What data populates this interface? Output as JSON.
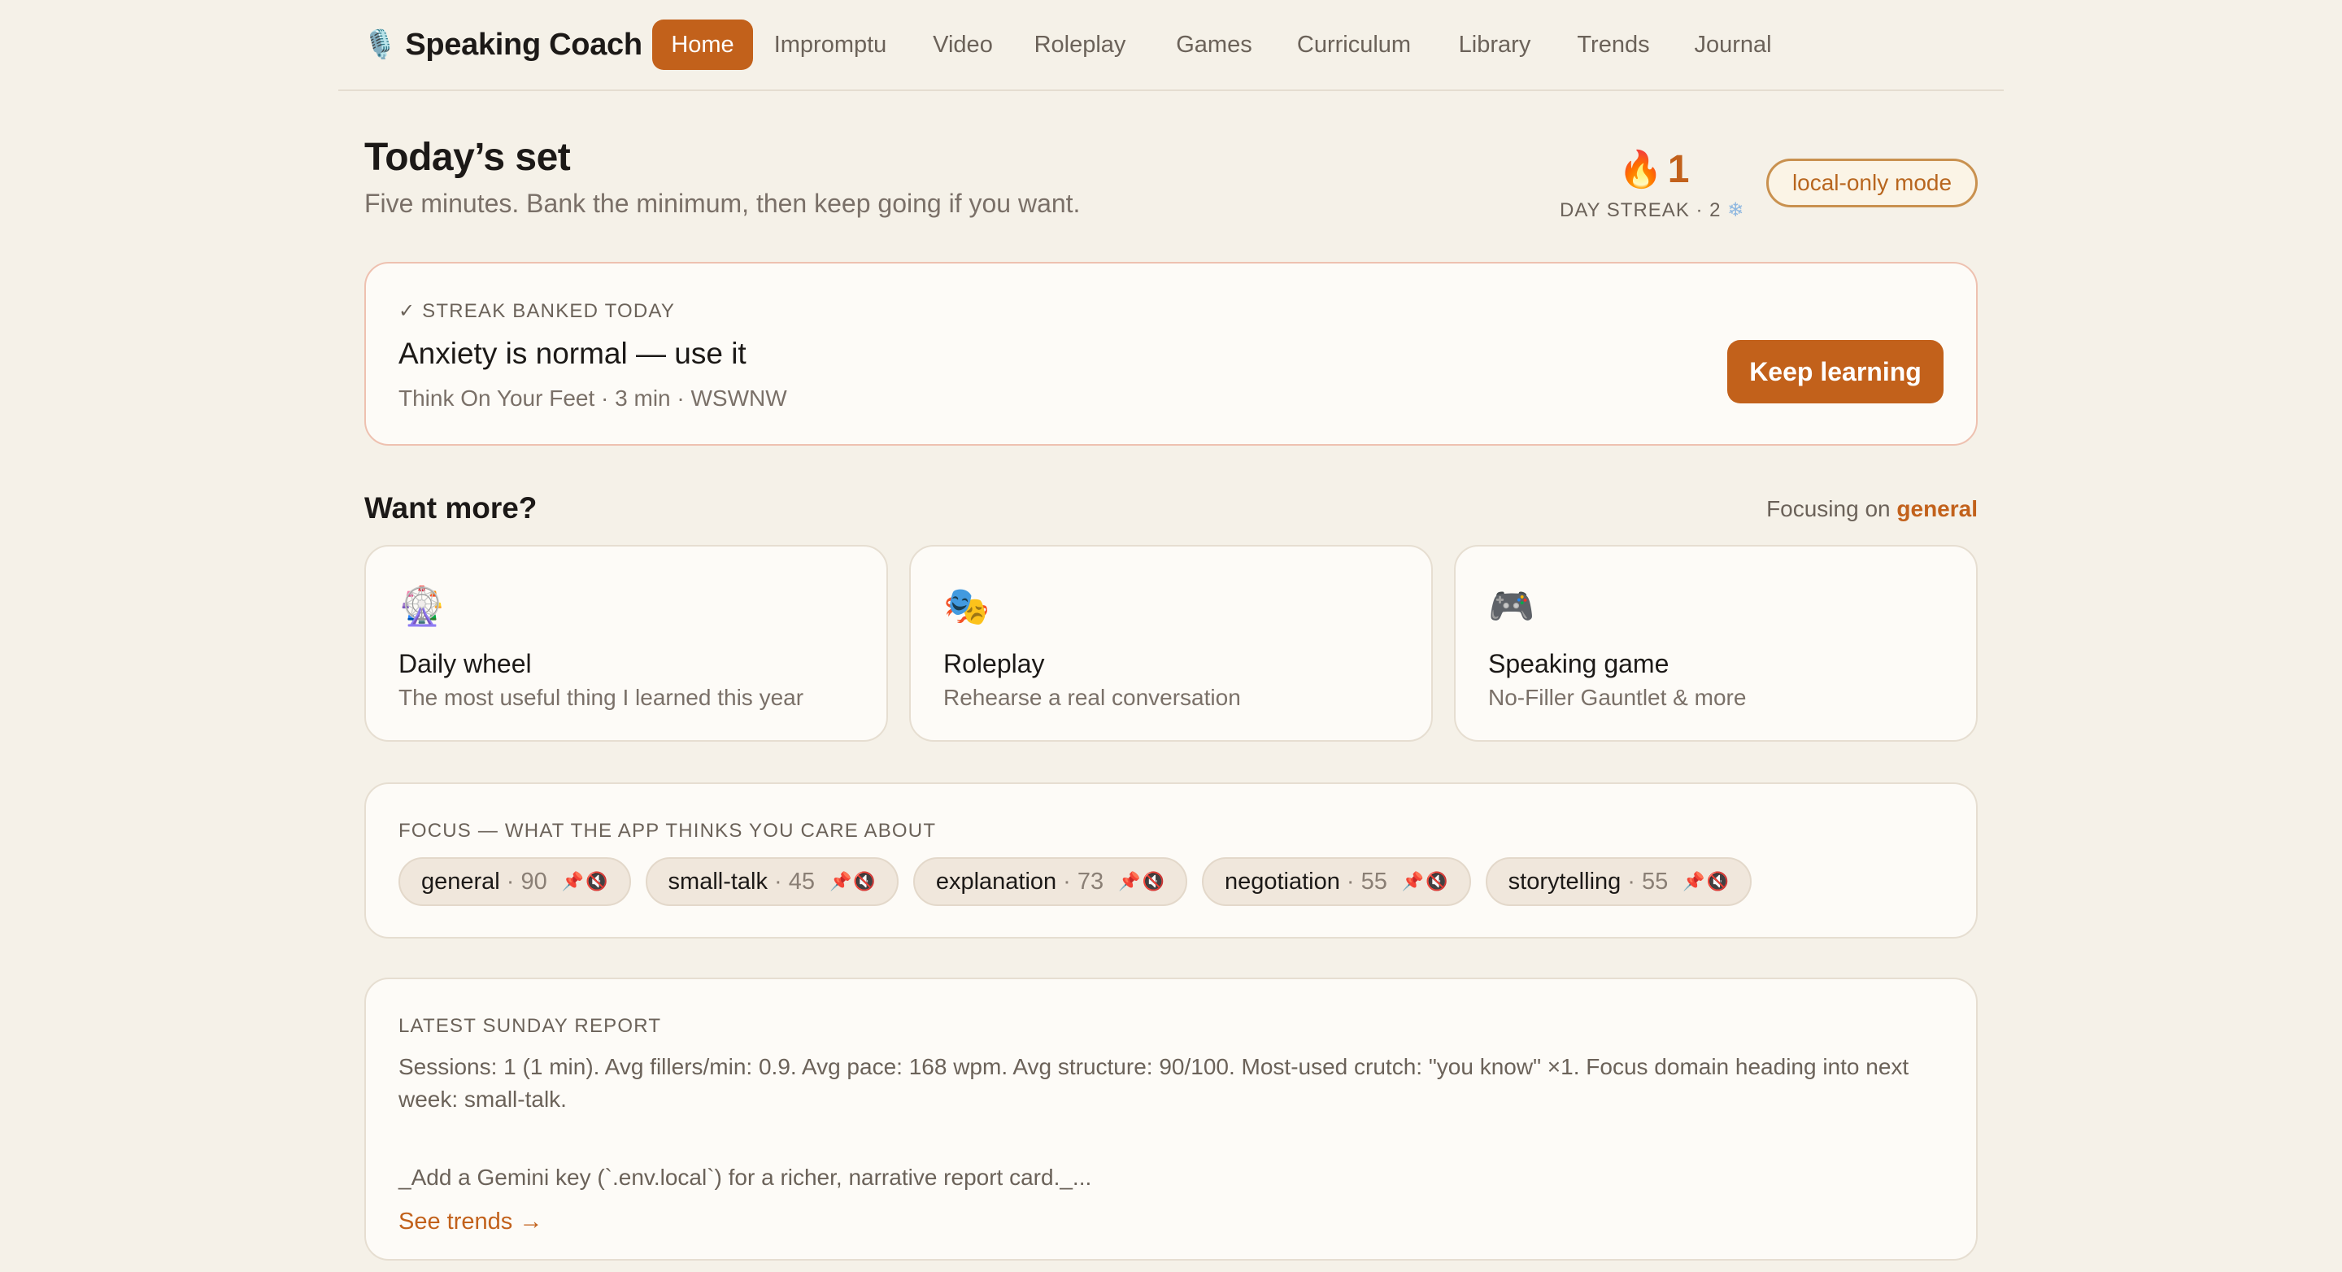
{
  "app": {
    "brand_icon": "microphone-icon",
    "brand_glyph": "🎙️",
    "name": "Speaking Coach"
  },
  "nav": {
    "items": [
      {
        "label": "Home",
        "active": true
      },
      {
        "label": "Impromptu"
      },
      {
        "label": "Video"
      },
      {
        "label": "Roleplay"
      },
      {
        "label": "Games"
      },
      {
        "label": "Curriculum"
      },
      {
        "label": "Library"
      },
      {
        "label": "Trends"
      },
      {
        "label": "Journal"
      }
    ]
  },
  "header": {
    "title": "Today’s set",
    "subtitle": "Five minutes. Bank the minimum, then keep going if you want.",
    "streak": {
      "icon": "flame-icon",
      "glyph": "🔥",
      "count": "1",
      "label": "DAY STREAK · 2",
      "freeze_icon": "snowflake-icon",
      "freeze_glyph": "❄"
    },
    "mode": "local-only mode"
  },
  "banked": {
    "eyebrow": "✓ STREAK BANKED TODAY",
    "title": "Anxiety is normal — use it",
    "meta": "Think On Your Feet · 3 min · WSWNW",
    "cta": "Keep learning"
  },
  "more": {
    "title": "Want more?",
    "focusing_prefix": "Focusing on",
    "focusing_value": "general",
    "tiles": [
      {
        "icon": "ferris-wheel-icon",
        "glyph": "🎡",
        "title": "Daily wheel",
        "desc": "The most useful thing I learned this year"
      },
      {
        "icon": "theater-masks-icon",
        "glyph": "🎭",
        "title": "Roleplay",
        "desc": "Rehearse a real conversation"
      },
      {
        "icon": "game-controller-icon",
        "glyph": "🎮",
        "title": "Speaking game",
        "desc": "No-Filler Gauntlet & more"
      }
    ]
  },
  "focus": {
    "eyebrow": "FOCUS — WHAT THE APP THINKS YOU CARE ABOUT",
    "chips": [
      {
        "label": "general",
        "score": "· 90"
      },
      {
        "label": "small-talk",
        "score": "· 45"
      },
      {
        "label": "explanation",
        "score": "· 73"
      },
      {
        "label": "negotiation",
        "score": "· 55"
      },
      {
        "label": "storytelling",
        "score": "· 55"
      }
    ],
    "pin_glyph": "📌",
    "mute_glyph": "🔇"
  },
  "report": {
    "eyebrow": "LATEST SUNDAY REPORT",
    "body": "Sessions: 1 (1 min). Avg fillers/min: 0.9. Avg pace: 168 wpm. Avg structure: 90/100. Most-used crutch: \"you know\" ×1. Focus domain heading into next week: small-talk.",
    "note": "_Add a Gemini key (`.env.local`) for a richer, narrative report card._...",
    "link": "See trends →"
  }
}
